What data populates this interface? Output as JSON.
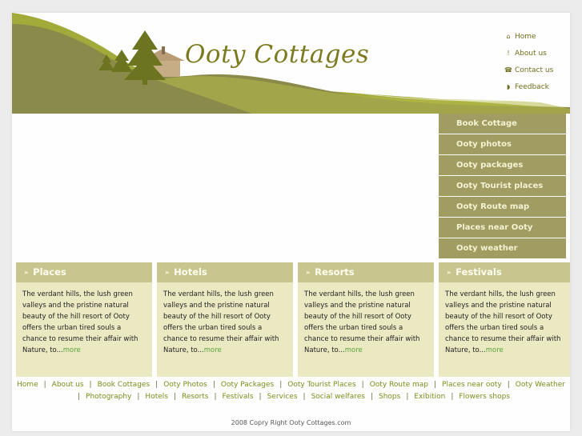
{
  "brand": {
    "logo_text": "Ooty Cottages"
  },
  "top_nav": [
    {
      "icon": "home-icon",
      "glyph": "⌂",
      "label": "Home"
    },
    {
      "icon": "info-icon",
      "glyph": "!",
      "label": "About us"
    },
    {
      "icon": "phone-icon",
      "glyph": "☎",
      "label": "Contact us"
    },
    {
      "icon": "rss-icon",
      "glyph": "◗",
      "label": "Feedback"
    }
  ],
  "side_menu": [
    {
      "label": "Book Cottage"
    },
    {
      "label": "Ooty photos"
    },
    {
      "label": "Ooty packages"
    },
    {
      "label": "Ooty Tourist places"
    },
    {
      "label": "Ooty Route map"
    },
    {
      "label": "Places near Ooty"
    },
    {
      "label": "Ooty weather"
    }
  ],
  "cards": [
    {
      "title": "Places",
      "text": "The verdant hills, the lush green valleys and the pristine natural beauty of the hill resort of Ooty offers the urban tired souls a chance to resume their affair with Nature, to...",
      "more": "more"
    },
    {
      "title": "Hotels",
      "text": "The verdant hills, the lush green valleys and the pristine natural beauty of the hill resort of Ooty offers the urban tired souls a chance to resume their affair with Nature, to...",
      "more": "more"
    },
    {
      "title": "Resorts",
      "text": "The verdant hills, the lush green valleys and the pristine natural beauty of the hill resort of Ooty offers the urban tired souls a chance to resume their affair with Nature, to...",
      "more": "more"
    },
    {
      "title": "Festivals",
      "text": "The verdant hills, the lush green valleys and the pristine natural beauty of the hill resort of Ooty offers the urban tired souls a chance to resume their affair with Nature, to...",
      "more": "more"
    }
  ],
  "footer_row1": [
    "Home",
    "About us",
    "Book Cottages",
    "Ooty Photos",
    "Ooty Packages",
    "Ooty Tourist Places",
    "Ooty Route map",
    "Places near ooty",
    "Ooty Weather"
  ],
  "footer_row2": [
    "Photography",
    "Hotels",
    "Resorts",
    "Festivals",
    "Services",
    "Social welfares",
    "Shops",
    "Exibition",
    "Flowers shops"
  ],
  "copyright": "2008 Copry Right Ooty Cottages.com",
  "colors": {
    "hill_dark": "#8a8a4a",
    "hill_light": "#a2ab3a",
    "menu_bg": "#a09c62",
    "card_head": "#c8c68e",
    "card_body": "#eae9c2",
    "link": "#7a8d1a"
  }
}
